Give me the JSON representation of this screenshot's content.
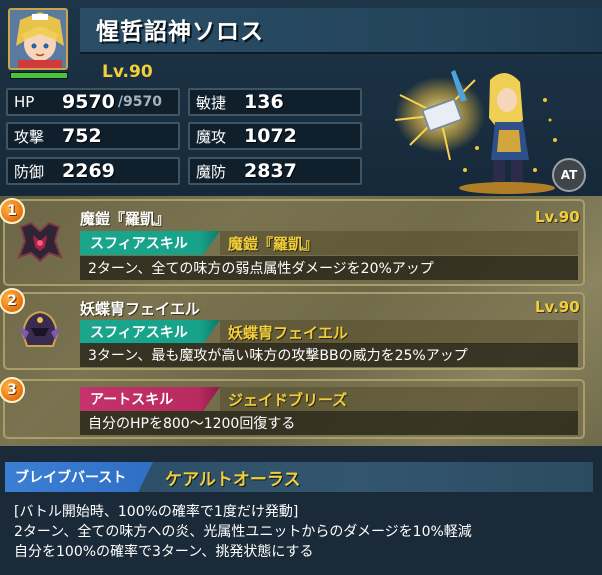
{
  "unit": {
    "name": "惺哲詔神ソロス",
    "level": "Lv.90",
    "hp_fraction": 1.0
  },
  "stats": {
    "hp": {
      "label": "HP",
      "value": "9570",
      "max": "/9570"
    },
    "agility": {
      "label": "敏捷",
      "value": "136"
    },
    "attack": {
      "label": "攻撃",
      "value": "752"
    },
    "magic_attack": {
      "label": "魔攻",
      "value": "1072"
    },
    "defense": {
      "label": "防御",
      "value": "2269"
    },
    "magic_defense": {
      "label": "魔防",
      "value": "2837"
    }
  },
  "at_badge": "AT",
  "spheres": [
    {
      "number": "1",
      "name": "魔鎧『羅凱』",
      "level": "Lv.90",
      "skill_type": "スフィアスキル",
      "skill_name": "魔鎧『羅凱』",
      "description": "2ターン、全ての味方の弱点属性ダメージを20%アップ"
    },
    {
      "number": "2",
      "name": "妖蝶冑フェイエル",
      "level": "Lv.90",
      "skill_type": "スフィアスキル",
      "skill_name": "妖蝶冑フェイエル",
      "description": "3ターン、最も魔攻が高い味方の攻撃BBの威力を25%アップ"
    }
  ],
  "art_skill": {
    "number": "3",
    "skill_type": "アートスキル",
    "skill_name": "ジェイドブリーズ",
    "description": "自分のHPを800～1200回復する"
  },
  "brave_burst": {
    "label": "ブレイブバースト",
    "name": "ケアルトオーラス",
    "lines": [
      "[バトル開始時、100%の確率で1度だけ発動]",
      "2ターン、全ての味方への炎、光属性ユニットからのダメージを10%軽減",
      "自分を100%の確率で3ターン、挑発状態にする"
    ]
  },
  "colors": {
    "level_gold": "#f2cf3a",
    "sphere_tag": "#1aa58c",
    "art_tag": "#c4336b",
    "bb_tag": "#3b7fd4",
    "badge_orange": "#e5720f"
  }
}
